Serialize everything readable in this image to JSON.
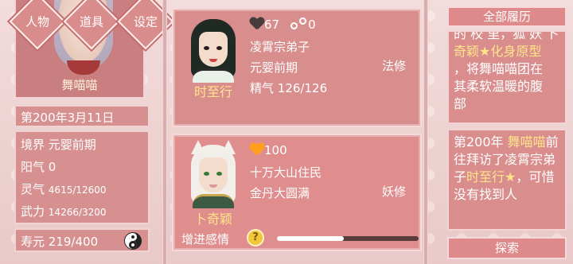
{
  "player": {
    "name": "舞喵喵",
    "menu": [
      "人物",
      "道具",
      "设定"
    ],
    "date": "第200年3月11日",
    "attributes": [
      {
        "label": "境界",
        "value": "元婴前期"
      },
      {
        "label": "阳气",
        "value": "0"
      },
      {
        "label": "灵气",
        "value": "4615/12600"
      },
      {
        "label": "武力",
        "value": "14266/3200"
      }
    ],
    "lifespan_label": "寿元",
    "lifespan_value": "219/400"
  },
  "characters": [
    {
      "name": "时至行",
      "affection": "67",
      "captured": "0",
      "sect": "凌霄宗弟子",
      "realm": "元婴前期",
      "cultivation_type": "法修",
      "essence_label": "精气",
      "essence_value": "126/126"
    },
    {
      "name": "卜奇颖",
      "affection": "100",
      "sect": "十万大山住民",
      "realm": "金丹大圆满",
      "cultivation_type": "妖修",
      "affection_action": "增进感情",
      "affection_progress_pct": 47
    }
  ],
  "history": {
    "button": "全部履历",
    "entry1": {
      "lines": [
        "的 校 里，狐 妖 卜",
        "奇颖★化身原型",
        "，将舞喵喵团在",
        "其柔软温暖的腹",
        "部"
      ]
    },
    "entry2": {
      "p1": "第200年 ",
      "p2": "舞喵喵",
      "p3": "前往拜访了凌霄宗弟子",
      "p4": "时至行★",
      "p5": "，可惜没有找到人"
    },
    "search": "探索"
  },
  "colors": {
    "panel": "#d98e8e",
    "highlight": "#ffe58a",
    "border": "#f6d9d9"
  }
}
